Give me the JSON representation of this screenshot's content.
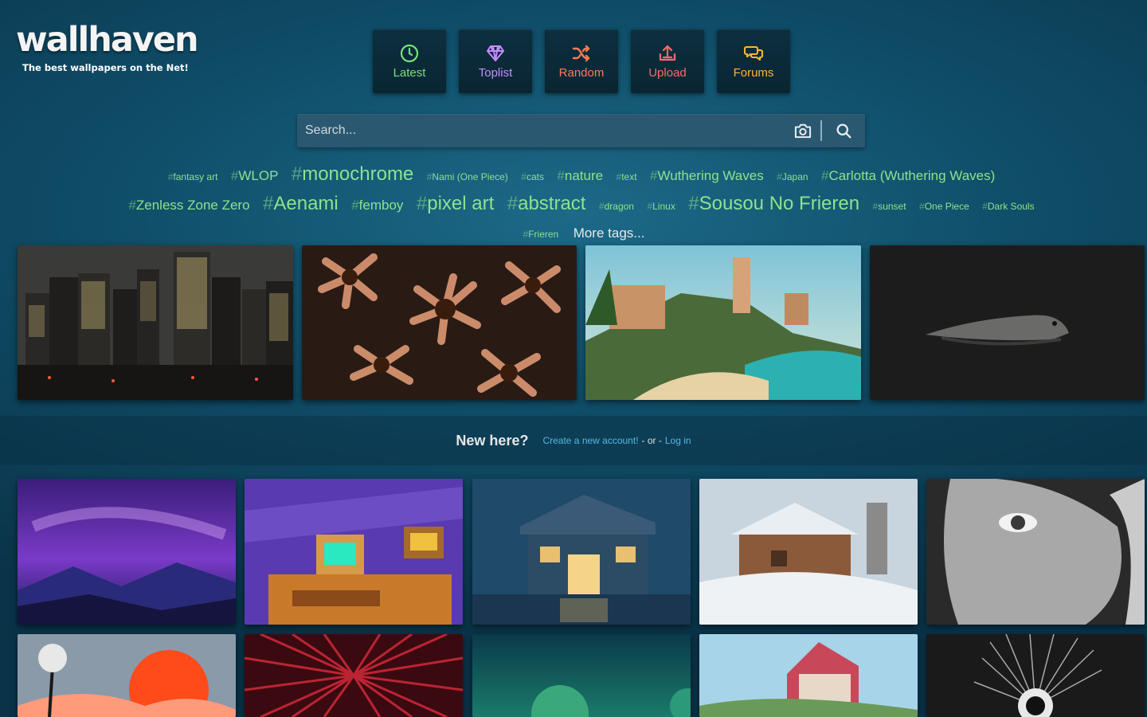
{
  "logo": {
    "name": "wallhaven",
    "tagline": "The best wallpapers on the Net!"
  },
  "nav": [
    {
      "label": "Latest",
      "icon": "clock-icon",
      "color": "#7ae07a"
    },
    {
      "label": "Toplist",
      "icon": "diamond-icon",
      "color": "#c58cff"
    },
    {
      "label": "Random",
      "icon": "shuffle-icon",
      "color": "#ff7a55"
    },
    {
      "label": "Upload",
      "icon": "upload-icon",
      "color": "#ff6a6a"
    },
    {
      "label": "Forums",
      "icon": "chat-icon",
      "color": "#ffb340"
    }
  ],
  "search": {
    "placeholder": "Search...",
    "value": ""
  },
  "tags": [
    {
      "label": "fantasy art"
    },
    {
      "label": "WLOP"
    },
    {
      "label": "monochrome"
    },
    {
      "label": "Nami (One Piece)"
    },
    {
      "label": "cats"
    },
    {
      "label": "nature"
    },
    {
      "label": "text"
    },
    {
      "label": "Wuthering Waves"
    },
    {
      "label": "Japan"
    },
    {
      "label": "Carlotta (Wuthering Waves)"
    },
    {
      "label": "Zenless Zone Zero"
    },
    {
      "label": "Aenami"
    },
    {
      "label": "femboy"
    },
    {
      "label": "pixel art"
    },
    {
      "label": "abstract"
    },
    {
      "label": "dragon"
    },
    {
      "label": "Linux"
    },
    {
      "label": "Sousou No Frieren"
    },
    {
      "label": "sunset"
    },
    {
      "label": "One Piece"
    },
    {
      "label": "Dark Souls"
    },
    {
      "label": "Frieren"
    }
  ],
  "more_tags": "More tags...",
  "new_here": {
    "title": "New here?",
    "create_link": "Create a new account!",
    "or": "- or -",
    "login_link": "Log in"
  },
  "colors": {
    "tag": "#8ee28e",
    "link": "#56b8e6",
    "background": "#0f4d68"
  }
}
